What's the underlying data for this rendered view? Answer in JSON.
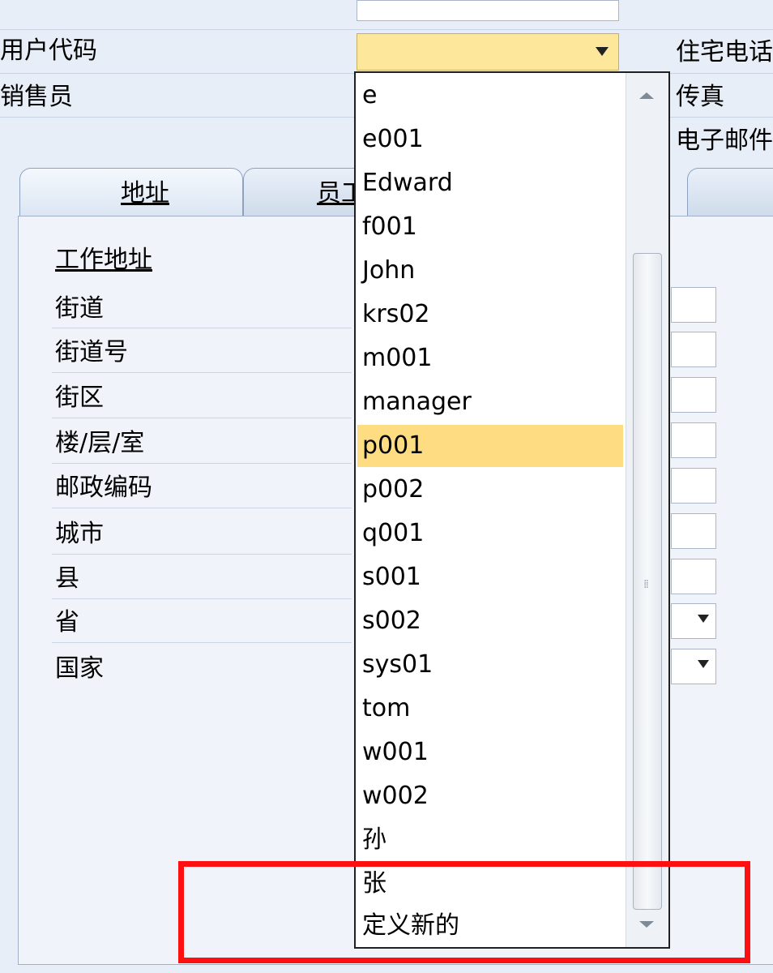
{
  "header": {
    "fields_left": [
      {
        "label": "用户代码"
      },
      {
        "label": "销售员"
      }
    ],
    "fields_right": [
      {
        "label": "住宅电话"
      },
      {
        "label": "传真"
      },
      {
        "label": "电子邮件"
      }
    ]
  },
  "tabs": [
    {
      "label": "地址",
      "active": true
    },
    {
      "label": "员工",
      "active": false
    }
  ],
  "address": {
    "section_title": "工作地址",
    "rows": [
      {
        "label": "街道"
      },
      {
        "label": "街道号"
      },
      {
        "label": "街区"
      },
      {
        "label": "楼/层/室"
      },
      {
        "label": "邮政编码"
      },
      {
        "label": "城市"
      },
      {
        "label": "县"
      },
      {
        "label": "省"
      },
      {
        "label": "国家"
      }
    ]
  },
  "dropdown": {
    "selected": "p001",
    "options": [
      "e",
      "e001",
      "Edward",
      "f001",
      "John",
      "krs02",
      "m001",
      "manager",
      "p001",
      "p002",
      "q001",
      "s001",
      "s002",
      "sys01",
      "tom",
      "w001",
      "w002",
      "孙",
      "张",
      "定义新的"
    ]
  },
  "colors": {
    "background": "#e8eef7",
    "selected_field": "#fde79a",
    "selected_option": "#fddc82",
    "highlight_box": "#ff1010"
  },
  "icons": {
    "dropdown_arrow": "chevron-down-icon",
    "scroll_up": "scroll-up-icon",
    "scroll_down": "scroll-down-icon"
  }
}
